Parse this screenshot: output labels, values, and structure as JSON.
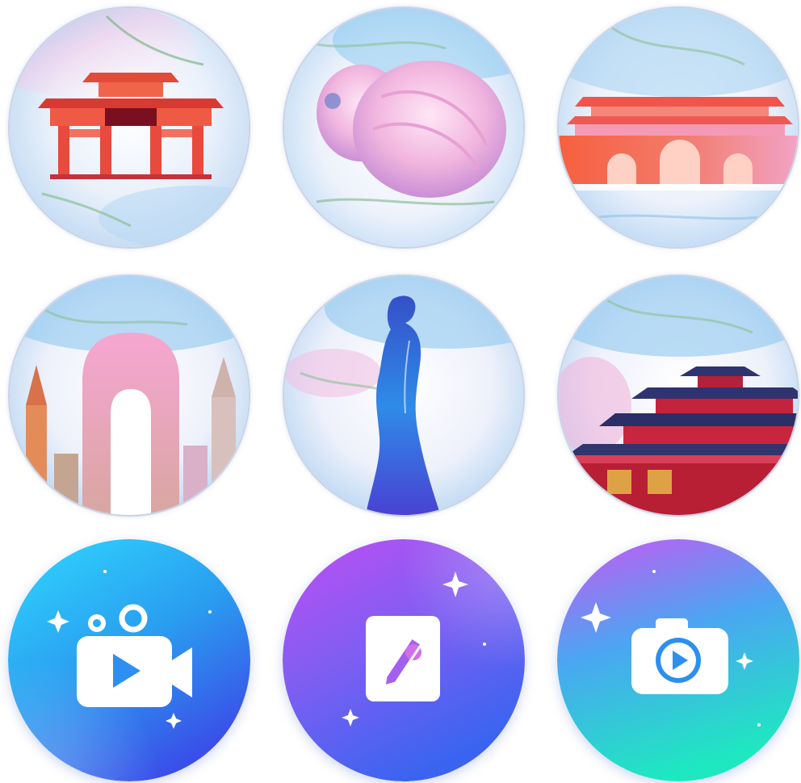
{
  "tiles": [
    {
      "id": "gate",
      "icon": "red-memorial-gate-icon",
      "colors": {
        "primary": "#e8443a",
        "accent": "#a0102a"
      }
    },
    {
      "id": "bun",
      "icon": "pink-steamed-bun-icon",
      "colors": {
        "primary": "#f2b9df"
      }
    },
    {
      "id": "wall",
      "icon": "city-wall-tower-icon",
      "colors": {
        "primary": "#f25a3c",
        "accent": "#f6a0b8"
      }
    },
    {
      "id": "temple-ruins",
      "icon": "stone-archway-ruins-icon",
      "colors": {
        "primary": "#f08cb4"
      }
    },
    {
      "id": "lady",
      "icon": "lady-silhouette-icon",
      "colors": {
        "primary": "#3a5fe0"
      }
    },
    {
      "id": "pavilion",
      "icon": "red-pavilion-icon",
      "colors": {
        "primary": "#c4233c"
      }
    },
    {
      "id": "video",
      "icon": "video-camera-icon",
      "colors": {
        "from": "#27d3ff",
        "to": "#3a4fe8"
      }
    },
    {
      "id": "note",
      "icon": "edit-note-icon",
      "colors": {
        "from": "#b14cf0",
        "to": "#3a64f0"
      }
    },
    {
      "id": "photo",
      "icon": "camera-play-icon",
      "colors": {
        "from": "#c05cf3",
        "to": "#20e8c6"
      }
    }
  ]
}
